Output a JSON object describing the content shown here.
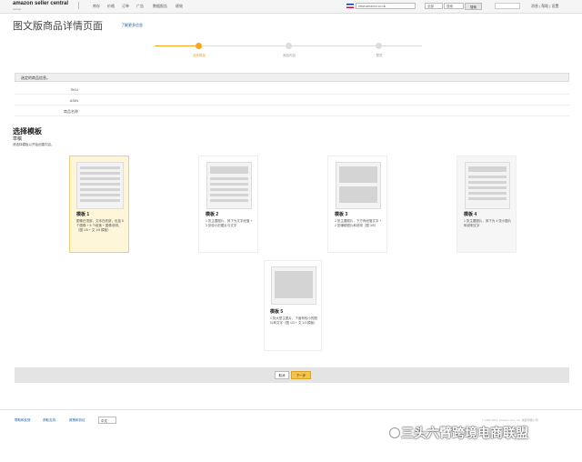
{
  "header": {
    "logo_main": "amazon seller central",
    "logo_sub": "europe",
    "nav": [
      "库存",
      "价格",
      "订单",
      "广告",
      "数据报告",
      "绩效"
    ],
    "marketplace": "www.amazon.co.uk",
    "search_scope": "全部",
    "search_placeholder": "搜索",
    "go_label": "搜索",
    "right_links": "消息 | 帮助 | 设置"
  },
  "page": {
    "title": "图文版商品详情页面",
    "help_link": "了解更多信息"
  },
  "steps": [
    {
      "label": "选择模板",
      "active": true
    },
    {
      "label": "添加内容",
      "active": false
    },
    {
      "label": "预览",
      "active": false
    }
  ],
  "info": {
    "heading": "选定的商品信息。",
    "rows": [
      {
        "label": "SKU"
      },
      {
        "label": "ASIN"
      },
      {
        "label": "商品名称"
      }
    ]
  },
  "section": {
    "title": "选择模板",
    "subtitle": "草稿",
    "description": "请选择模板以开始创建内容。"
  },
  "templates": [
    {
      "title": "模板 1",
      "desc": "图像在顶部，文本在底部，包括 5 个图像 + 5 个段落 + 图像说明，（图 1/5 + 文 1/5 模板）",
      "selected": true
    },
    {
      "title": "模板 2",
      "desc": "1 张主要图片，其下为文字段落 + 3 张较小的图片与文字",
      "selected": false
    },
    {
      "title": "模板 3",
      "desc": "2 张主要图片，下方有段落文字 + 2 张辅助图片和说明（图 3/5）",
      "selected": false
    },
    {
      "title": "模板 4",
      "desc": "1 张主要图片，其下为 4 张小图片和说明文字",
      "selected": false
    },
    {
      "title": "模板 5",
      "desc": "1 张大型主图片，下面有较小的图片和文字（图 1/3 + 文 1/3 模板）",
      "selected": false
    }
  ],
  "actions": {
    "cancel": "取消",
    "next": "下一步"
  },
  "footer": {
    "links": [
      "帮助和反馈",
      "获取支持",
      "政策和协议"
    ],
    "language": "中文",
    "copyright": "© 1999-2017, Amazon.com, Inc. 或其附属公司"
  },
  "watermark": "三头六臂跨境电商联盟",
  "colors": {
    "accent": "#f5a623",
    "next_button": "#f5c24a",
    "selected_card_bg": "#fdf6d8",
    "link": "#1a5ea8"
  }
}
